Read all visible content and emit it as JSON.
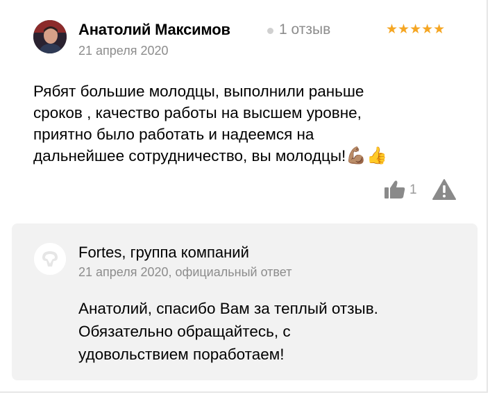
{
  "review": {
    "author": "Анатолий Максимов",
    "review_count": "1 отзыв",
    "stars": "★★★★★",
    "rating": 5,
    "date": "21 апреля 2020",
    "text": "Рябят большие молодцы, выполнили раньше\nсроков , качество работы на высшем уровне,\nприятно было работать и надеемся на\nдальнейшее сотрудничество, вы молодцы!",
    "emoji": "💪🏽👍",
    "likes": "1"
  },
  "reply": {
    "company": "Fortes, группа компаний",
    "meta": "21 апреля 2020, официальный ответ",
    "text": "Анатолий, спасибо Вам за теплый отзыв.\nОбязательно обращайтесь, с\nудовольствием поработаем!"
  },
  "colors": {
    "star": "#f5a623",
    "muted_text": "#8c8c8c",
    "reply_bg": "#f2f2f2",
    "icon_gray": "#8a8a8a"
  }
}
